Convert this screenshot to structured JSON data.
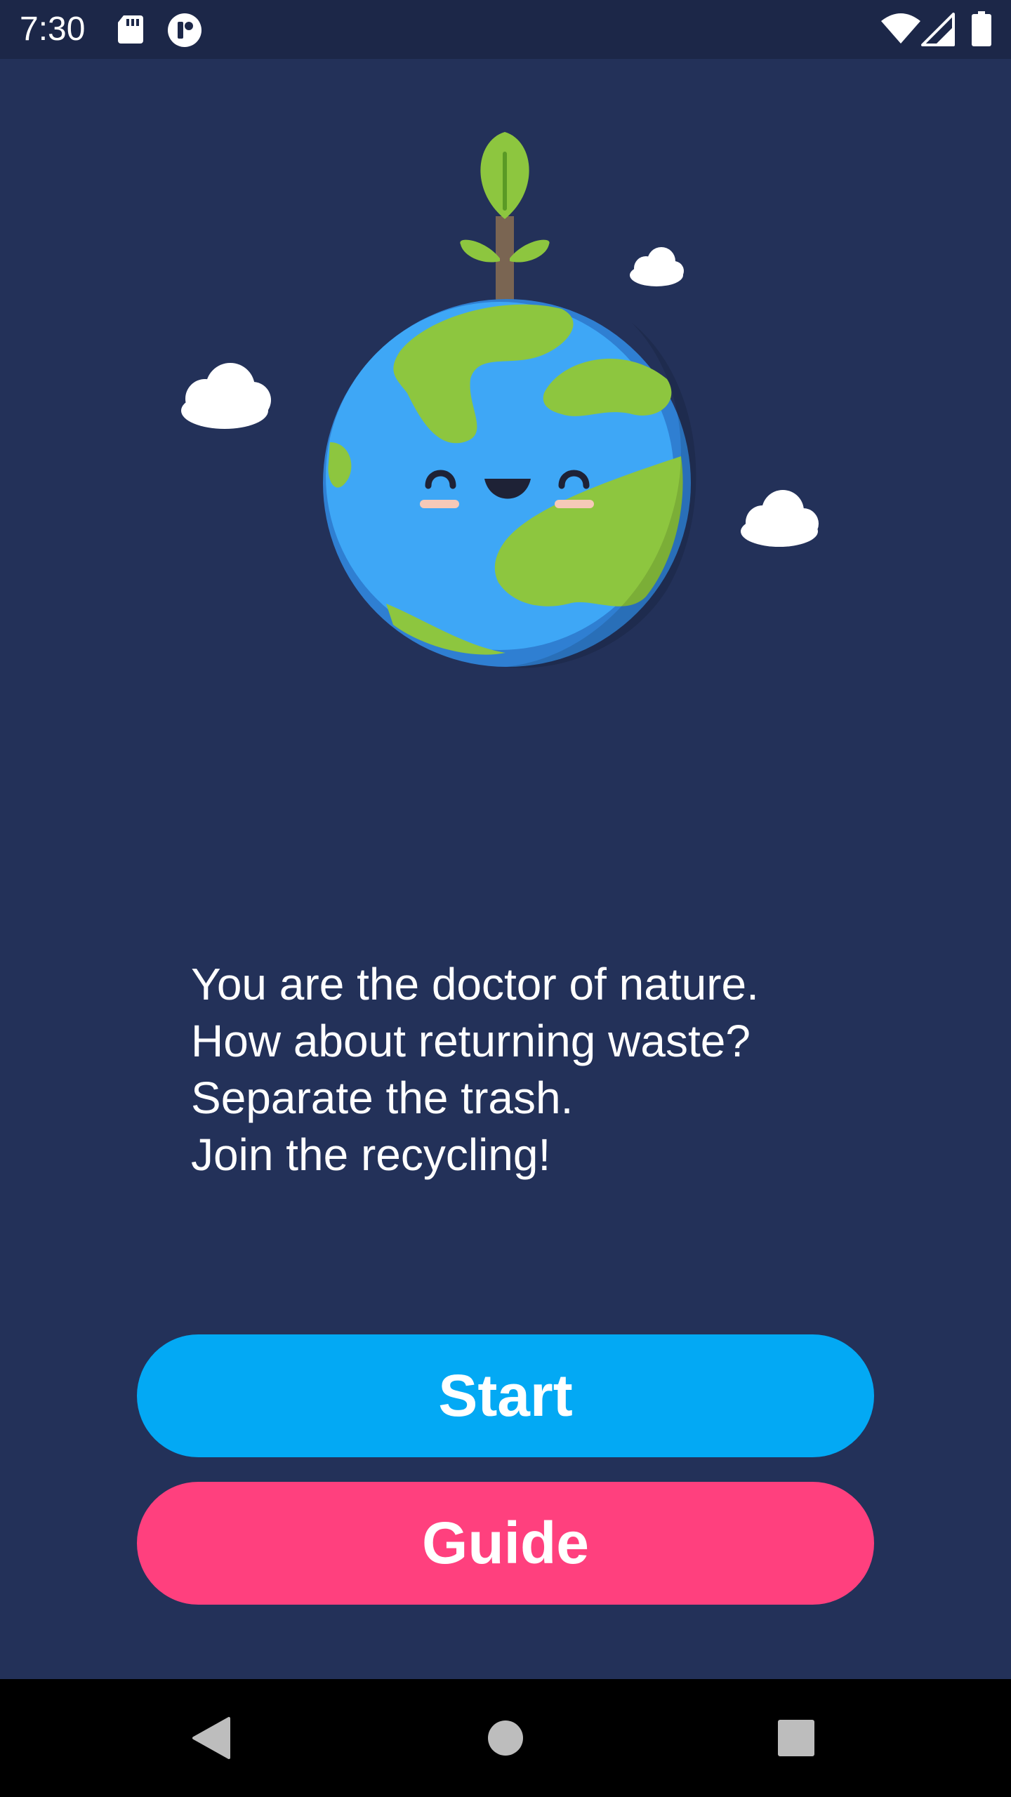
{
  "status_bar": {
    "time": "7:30",
    "icons": [
      "sd-card-icon",
      "app-notification-icon",
      "wifi-icon",
      "signal-icon",
      "battery-icon"
    ]
  },
  "illustration": {
    "subject": "earth-with-sprout-icon"
  },
  "message": {
    "lines": [
      "You are the doctor of nature.",
      "How about returning waste?",
      "Separate the trash.",
      "Join the recycling!"
    ]
  },
  "buttons": {
    "start_label": "Start",
    "guide_label": "Guide"
  },
  "navigation": {
    "icons": [
      "back-icon",
      "home-icon",
      "recents-icon"
    ]
  },
  "colors": {
    "background": "#233159",
    "status_bar": "#1c2748",
    "start_button": "#03a9f4",
    "guide_button": "#ff407e",
    "nav_bar": "#000000"
  }
}
